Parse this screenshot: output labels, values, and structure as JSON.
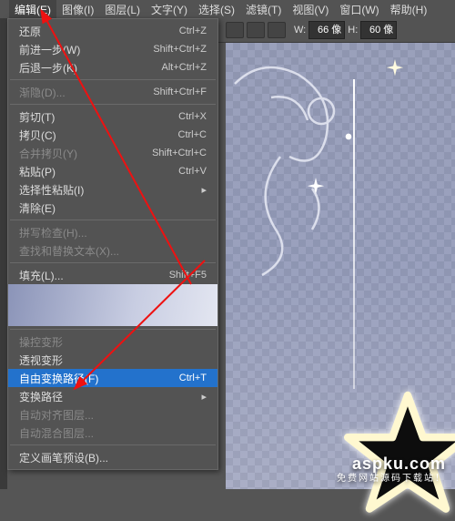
{
  "menubar": {
    "items": [
      {
        "label": "编辑(E)"
      },
      {
        "label": "图像(I)"
      },
      {
        "label": "图层(L)"
      },
      {
        "label": "文字(Y)"
      },
      {
        "label": "选择(S)"
      },
      {
        "label": "滤镜(T)"
      },
      {
        "label": "视图(V)"
      },
      {
        "label": "窗口(W)"
      },
      {
        "label": "帮助(H)"
      }
    ]
  },
  "toolbar": {
    "w_label": "W:",
    "w_value": "66 像",
    "h_label": "H:",
    "h_value": "60 像"
  },
  "dropdown": {
    "groups": [
      {
        "items": [
          {
            "label": "还原",
            "shortcut": "Ctrl+Z",
            "enabled": true
          },
          {
            "label": "前进一步(W)",
            "shortcut": "Shift+Ctrl+Z",
            "enabled": true
          },
          {
            "label": "后退一步(K)",
            "shortcut": "Alt+Ctrl+Z",
            "enabled": true
          }
        ]
      },
      {
        "items": [
          {
            "label": "渐隐(D)...",
            "shortcut": "Shift+Ctrl+F",
            "enabled": false
          }
        ]
      },
      {
        "items": [
          {
            "label": "剪切(T)",
            "shortcut": "Ctrl+X",
            "enabled": true
          },
          {
            "label": "拷贝(C)",
            "shortcut": "Ctrl+C",
            "enabled": true
          },
          {
            "label": "合并拷贝(Y)",
            "shortcut": "Shift+Ctrl+C",
            "enabled": false
          },
          {
            "label": "粘贴(P)",
            "shortcut": "Ctrl+V",
            "enabled": true
          },
          {
            "label": "选择性粘贴(I)",
            "shortcut": "",
            "enabled": true,
            "submenu": true
          },
          {
            "label": "清除(E)",
            "shortcut": "",
            "enabled": true
          }
        ]
      },
      {
        "items": [
          {
            "label": "拼写检查(H)...",
            "shortcut": "",
            "enabled": false
          },
          {
            "label": "查找和替换文本(X)...",
            "shortcut": "",
            "enabled": false
          }
        ]
      },
      {
        "items": [
          {
            "label": "填充(L)...",
            "shortcut": "Shift+F5",
            "enabled": true
          },
          {
            "label": "",
            "shortcut": "",
            "faded": true,
            "enabled": false
          }
        ]
      },
      {
        "items": [
          {
            "label": "操控变形",
            "shortcut": "",
            "enabled": false
          },
          {
            "label": "透视变形",
            "shortcut": "",
            "enabled": true
          },
          {
            "label": "自由变换路径(F)",
            "shortcut": "Ctrl+T",
            "enabled": true,
            "highlight": true
          },
          {
            "label": "变换路径",
            "shortcut": "",
            "enabled": true,
            "submenu": true
          },
          {
            "label": "自动对齐图层...",
            "shortcut": "",
            "enabled": false
          },
          {
            "label": "自动混合图层...",
            "shortcut": "",
            "enabled": false
          }
        ]
      },
      {
        "items": [
          {
            "label": "定义画笔预设(B)...",
            "shortcut": "",
            "enabled": true
          }
        ]
      }
    ]
  },
  "watermark": {
    "main": "aspku.com",
    "sub": "免费网站源码下载站！"
  }
}
